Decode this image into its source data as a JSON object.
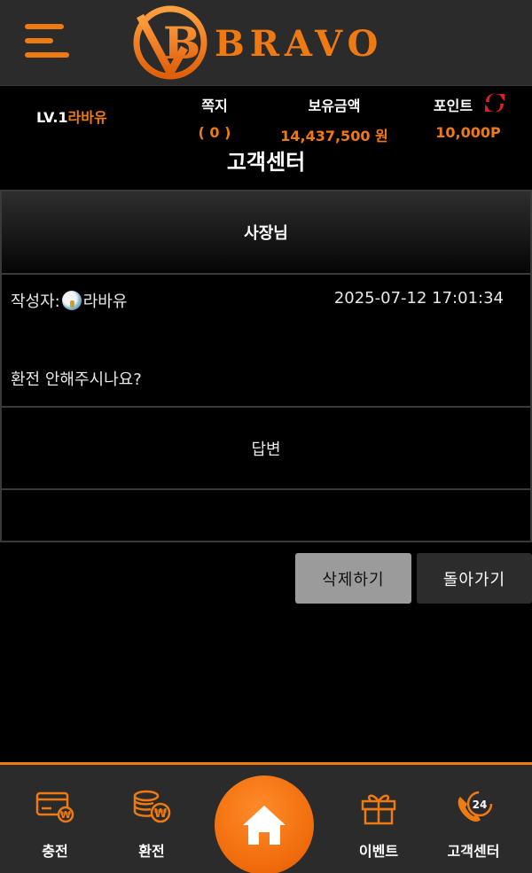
{
  "header": {
    "brand": "BRAVO",
    "logo_letter": "B",
    "menu_icon": "hamburger-menu-icon",
    "accent_color": "#f07a12"
  },
  "user_info": {
    "level": "LV.1",
    "username": "라바유",
    "messages_label": "쪽지",
    "messages_value": "( 0 )",
    "balance_label": "보유금액",
    "balance_value": "14,437,500 원",
    "points_label": "포인트",
    "points_value": "10,000P",
    "refresh_icon": "refresh-icon"
  },
  "page_title": "고객센터",
  "inquiry": {
    "subject": "사장님",
    "author_label": "작성자:",
    "author_name": "라바유",
    "date": "2025-07-12 17:01:34",
    "body": "환전 안해주시나요?",
    "answer_label": "답변",
    "answer_body": ""
  },
  "actions": {
    "delete_label": "삭제하기",
    "back_label": "돌아가기"
  },
  "bottom_nav": {
    "charge_label": "충전",
    "exchange_label": "환전",
    "home_icon": "home-icon",
    "event_label": "이벤트",
    "support_label": "고객센터",
    "support_badge": "24"
  }
}
